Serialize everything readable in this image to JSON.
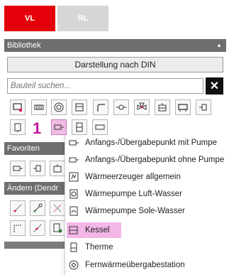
{
  "tabs": [
    {
      "label": "VL",
      "active": true,
      "color": "#e3000b"
    },
    {
      "label": "RL",
      "active": false,
      "color": "#d6d6d6"
    }
  ],
  "bibliothek": {
    "title": "Bibliothek",
    "din_button": "Darstellung nach DIN",
    "search_placeholder": "Bauteil suchen...",
    "clear_icon": "close-icon",
    "icons_row1": [
      "component-icon",
      "radiator-icon",
      "circle-pump-icon",
      "boiler-icon",
      "pipe-bend-icon",
      "valve-icon",
      "mixer-valve-icon",
      "tank-icon",
      "heater-icon",
      "connector-icon"
    ],
    "icons_row2": [
      "storage-icon",
      "transition-point-icon",
      "generator-icon",
      "rectangle-icon"
    ],
    "step_number": "1"
  },
  "favoriten": {
    "title": "Favoriten",
    "icons": [
      "transition-point-icon",
      "connector-icon",
      "tank-icon"
    ]
  },
  "aendern": {
    "title": "Ändern (Dendr",
    "icons_row1": [
      "edit-points-icon",
      "add-node-icon",
      "cut-icon"
    ],
    "icons_row2": [
      "corner-icon",
      "edge-icon",
      "new-doc-icon"
    ]
  },
  "dropdown": {
    "items": [
      {
        "label": "Anfangs-/Übergabepunkt mit Pumpe",
        "icon": "transition-pump-icon",
        "highlighted": false
      },
      {
        "label": "Anfangs-/Übergabepunkt ohne Pumpe",
        "icon": "transition-point-icon",
        "highlighted": false
      },
      {
        "label": "Wärmeerzeuger allgemein",
        "icon": "heat-generator-icon",
        "highlighted": false
      },
      {
        "label": "Wärmepumpe Luft-Wasser",
        "icon": "heat-pump-air-icon",
        "highlighted": false
      },
      {
        "label": "Wärmepumpe Sole-Wasser",
        "icon": "heat-pump-brine-icon",
        "highlighted": false
      },
      {
        "label": "Kessel",
        "icon": "boiler-icon",
        "highlighted": true
      },
      {
        "label": "Therme",
        "icon": "therme-icon",
        "highlighted": false
      },
      {
        "label": "Fernwärmeübergabestation",
        "icon": "district-heating-icon",
        "highlighted": false
      }
    ],
    "highlight_color": "#f3b6e6"
  },
  "colors": {
    "accent_red": "#e3000b",
    "section_gray": "#6e6e6e",
    "highlight_pink": "#f0bde3",
    "step_magenta": "#c2189b"
  }
}
